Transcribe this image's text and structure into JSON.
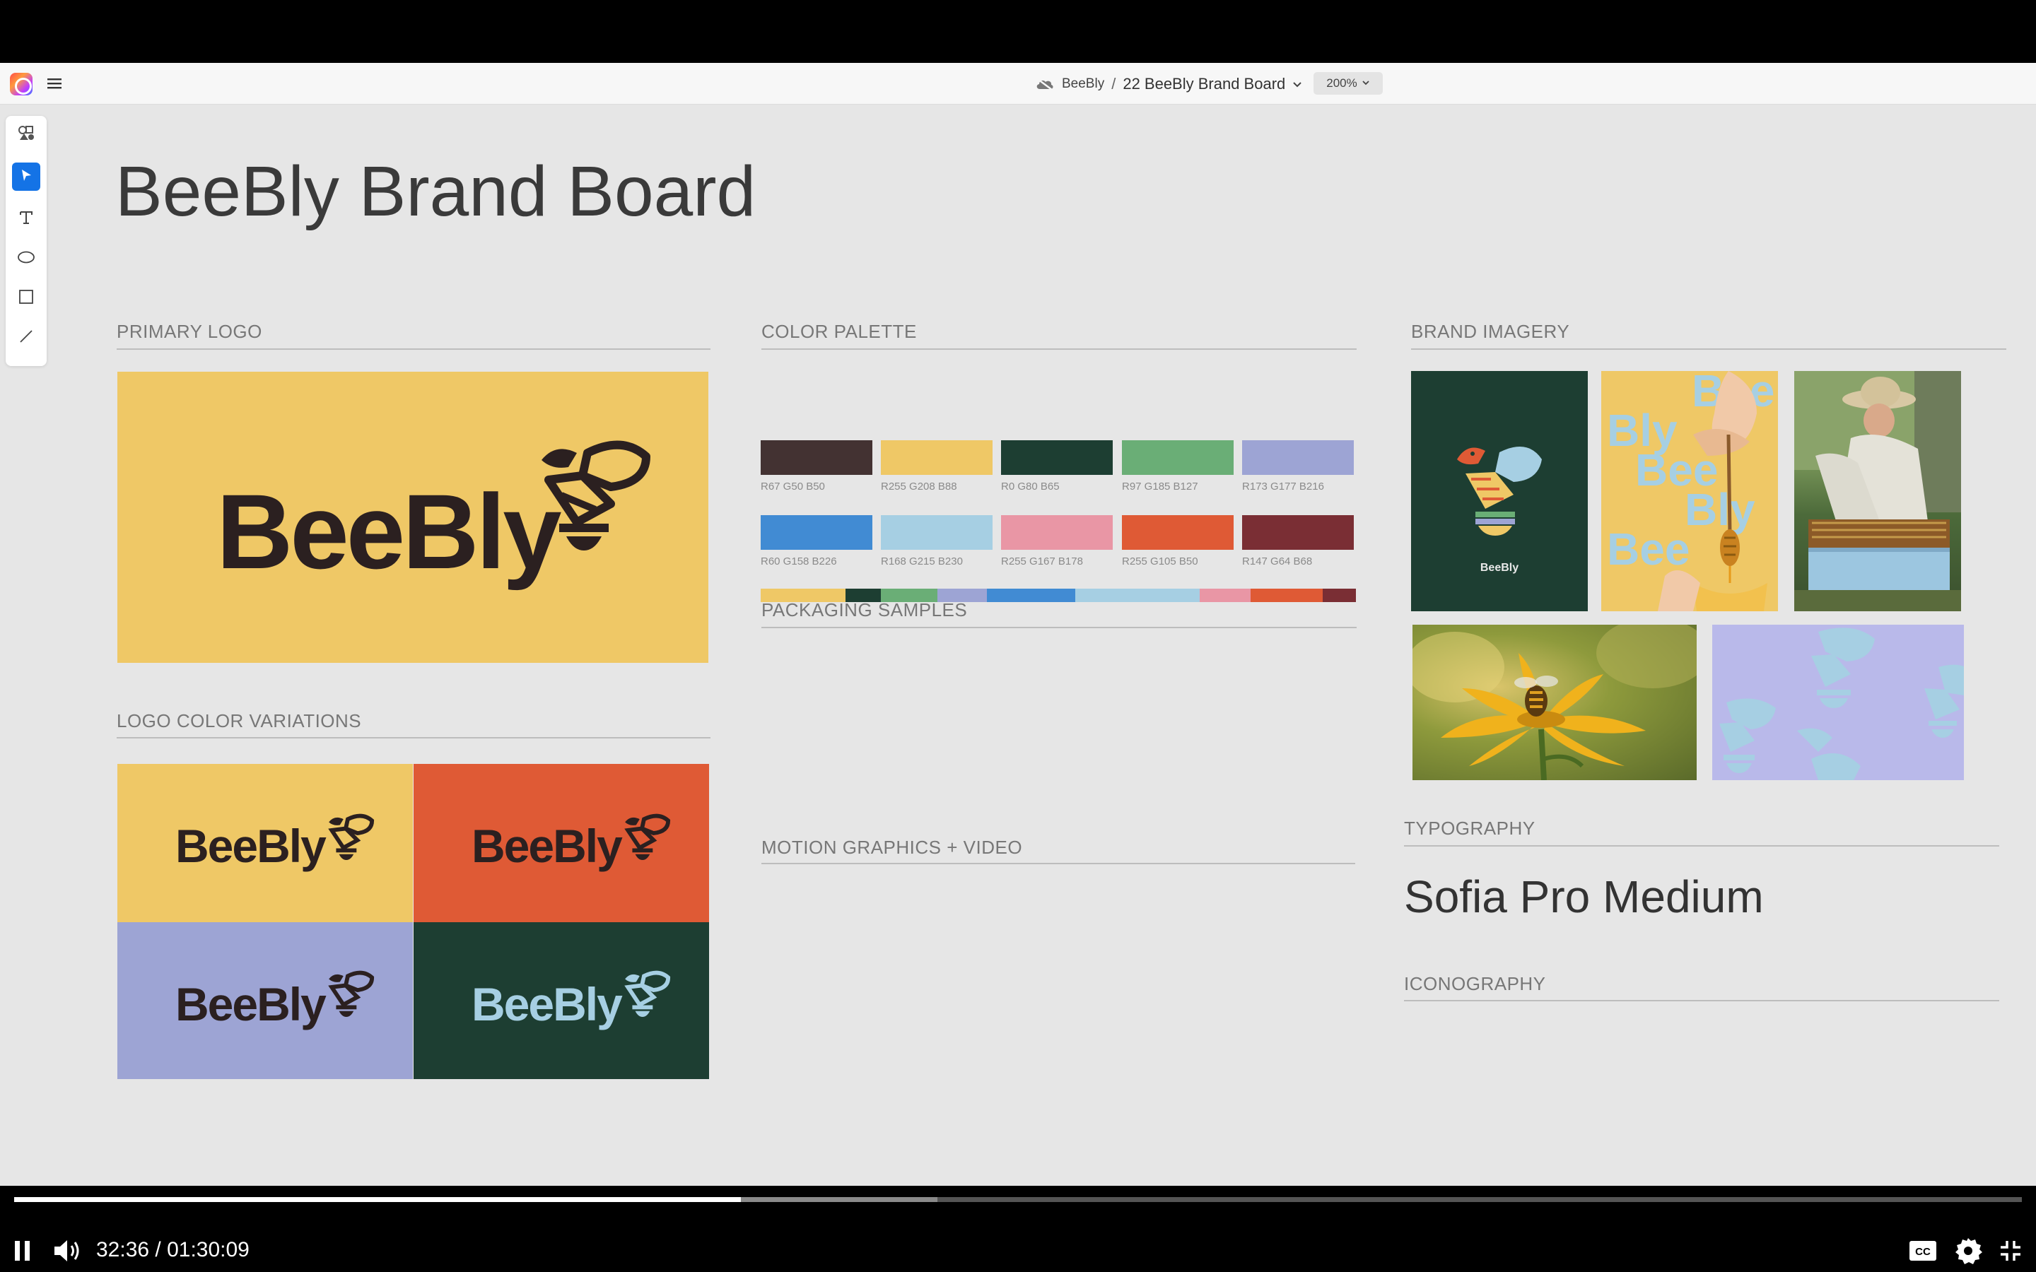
{
  "app": {
    "breadcrumb_owner": "BeeBly",
    "breadcrumb_sep": "/",
    "document_title": "22 BeeBly Brand Board",
    "zoom": "200%"
  },
  "board": {
    "title": "BeeBly Brand Board",
    "sections": {
      "primary_logo": "PRIMARY LOGO",
      "logo_variations": "LOGO COLOR VARIATIONS",
      "color_palette": "COLOR PALETTE",
      "packaging": "PACKAGING SAMPLES",
      "motion": "MOTION GRAPHICS + VIDEO",
      "imagery": "BRAND IMAGERY",
      "typography": "TYPOGRAPHY",
      "iconography": "ICONOGRAPHY"
    },
    "logo_word": "BeeBly",
    "typography_sample": "Sofia Pro Medium",
    "palette": [
      {
        "label": "R67 G50 B50",
        "color": "#433232"
      },
      {
        "label": "R255 G208 B88",
        "color": "#efc866"
      },
      {
        "label": "R0 G80 B65",
        "color": "#1d3e32"
      },
      {
        "label": "R97 G185 B127",
        "color": "#6aae76"
      },
      {
        "label": "R173 G177 B216",
        "color": "#9da4d4"
      },
      {
        "label": "R60 G158 B226",
        "color": "#418bd3"
      },
      {
        "label": "R168 G215 B230",
        "color": "#a6cfe3"
      },
      {
        "label": "R255 G167 B178",
        "color": "#e996a5"
      },
      {
        "label": "R255 G105 B50",
        "color": "#df5a35"
      },
      {
        "label": "R147 G64 B68",
        "color": "#7a2e34"
      }
    ],
    "imagery_poster_caption": "BeeBly",
    "imagery_poster_type": [
      "Bee",
      "Bly",
      "Bee",
      "Bly",
      "Bee"
    ]
  },
  "player": {
    "time_current": "32:36",
    "time_total": "01:30:09",
    "time_sep": " / ",
    "progress_fraction": 0.362,
    "buffer_fraction": 0.46
  }
}
